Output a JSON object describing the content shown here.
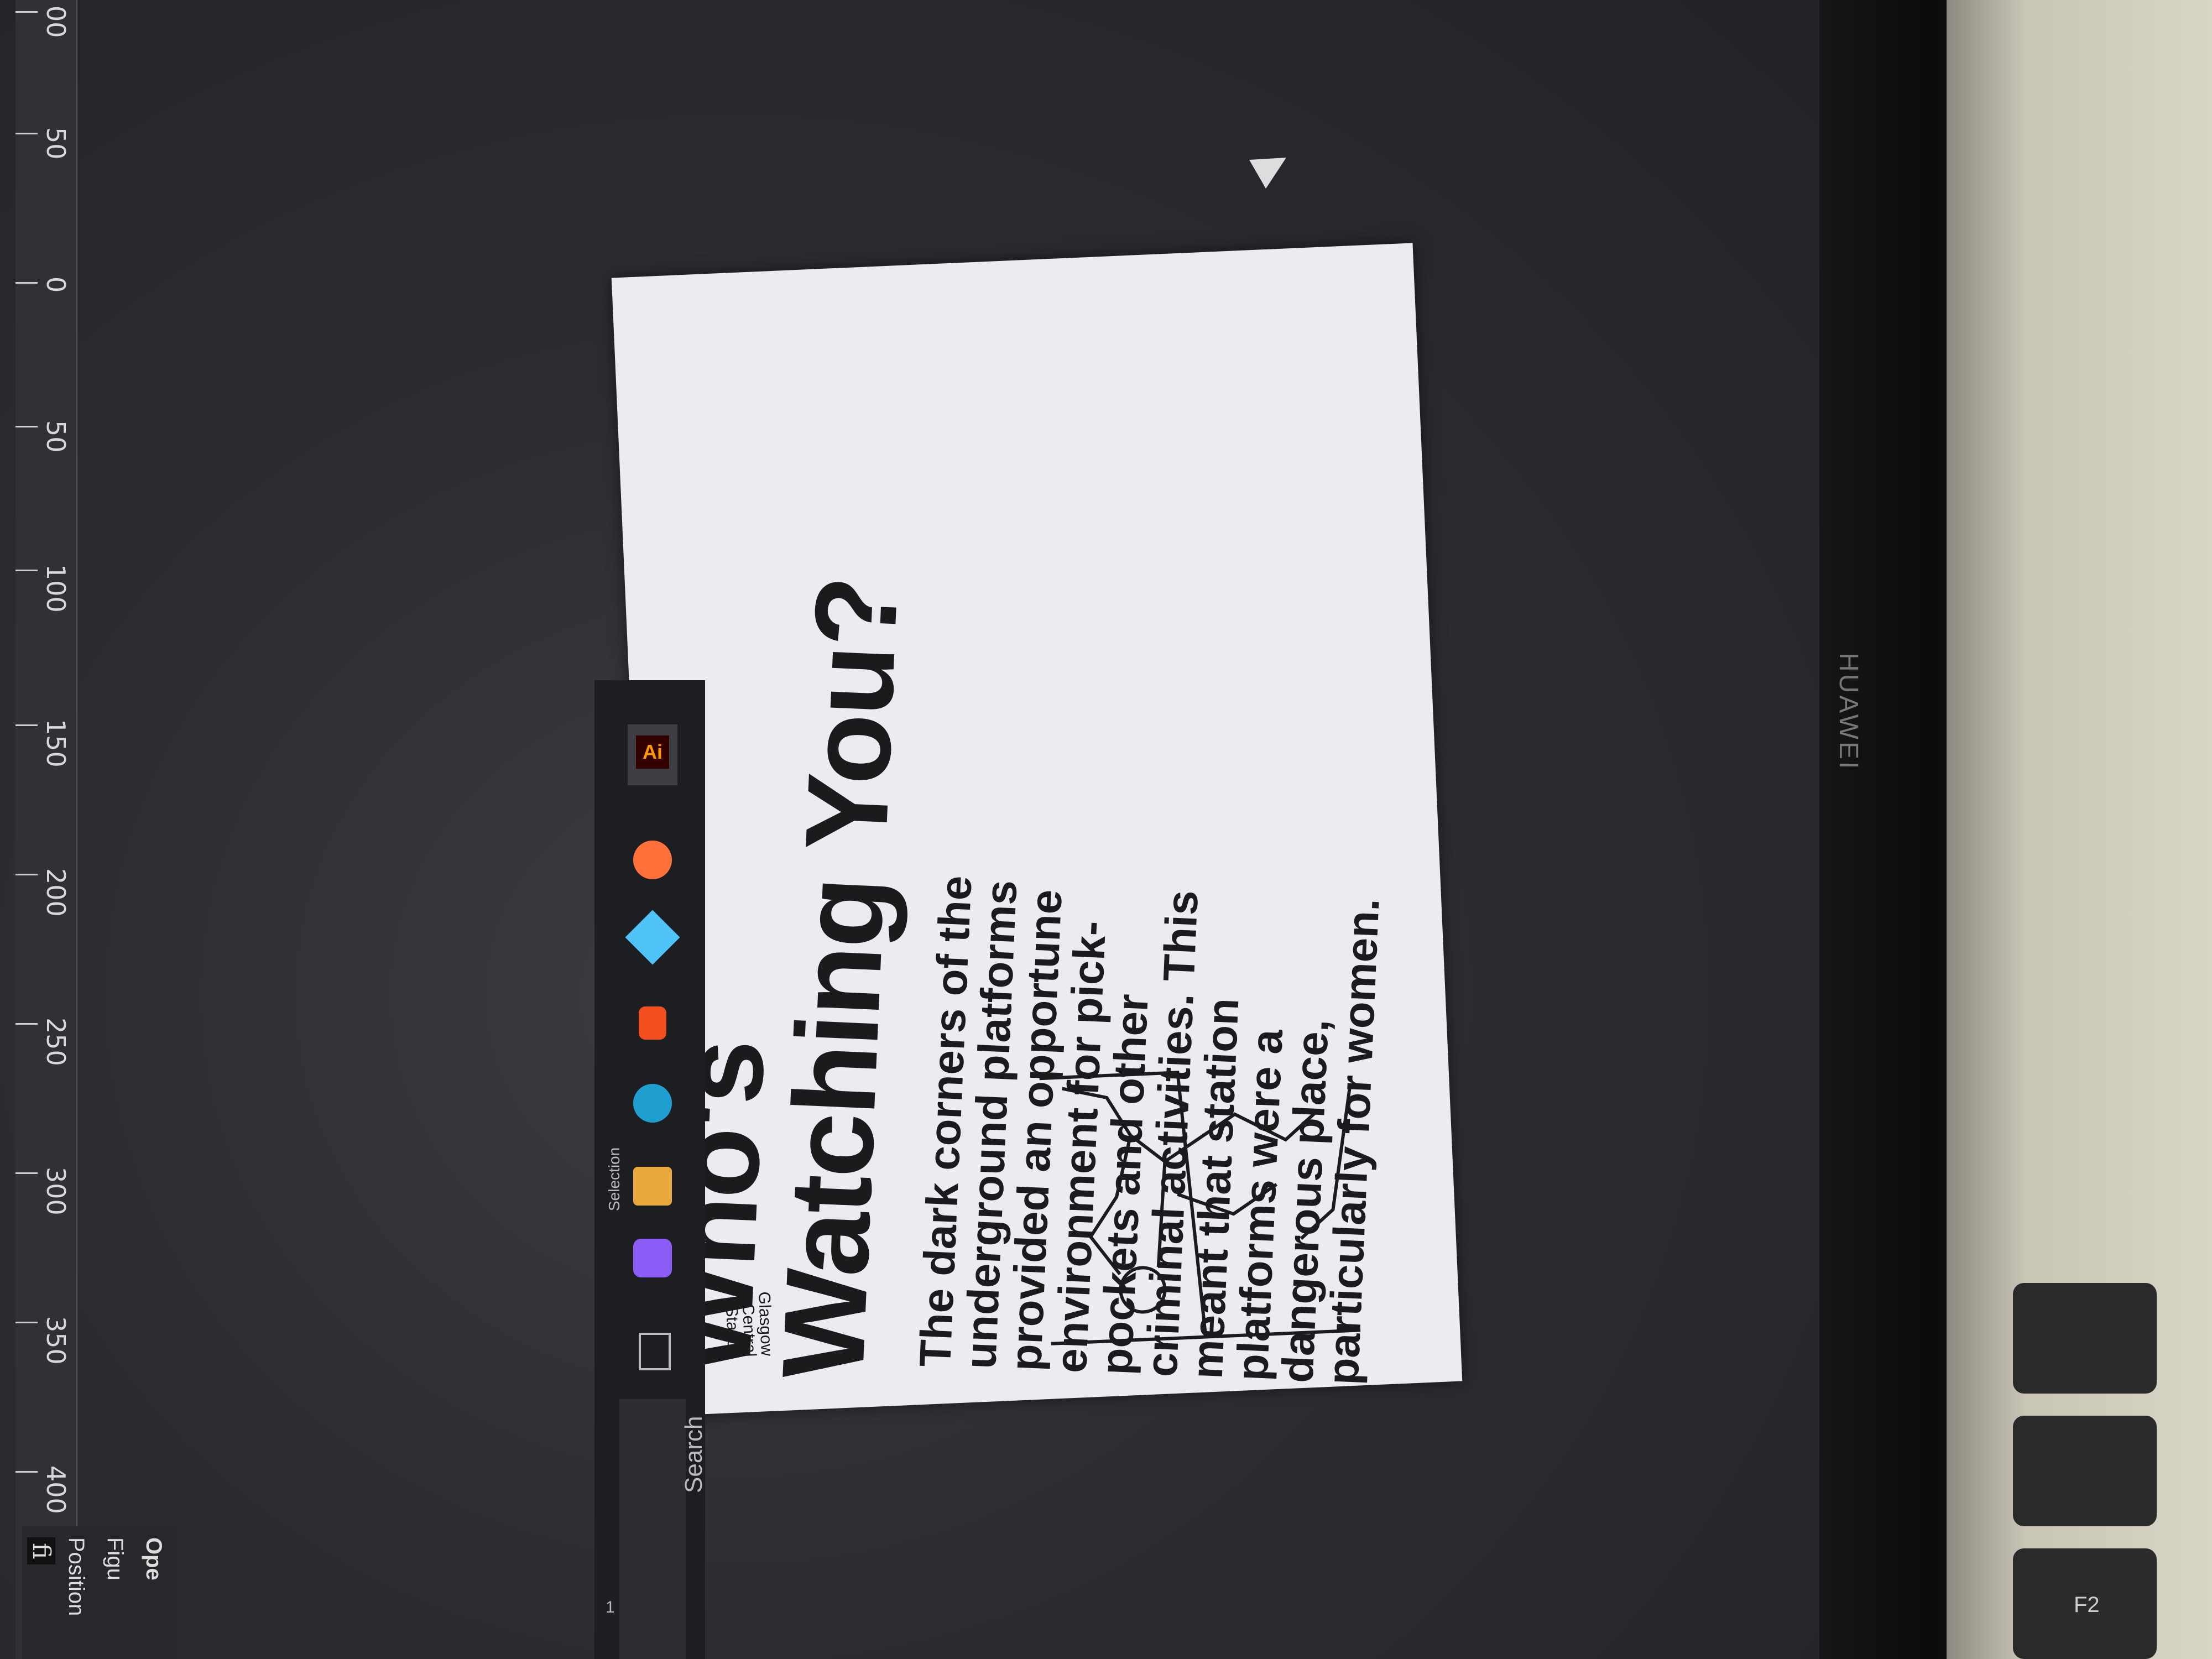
{
  "poster": {
    "title_line1": "Who's",
    "title_line2": "Watching You?",
    "body": "The dark corners of the underground platforms provided an opportune environment for pick-pockets and other criminal activities. This meant that station platforms were a dangerous place, particularly for women.",
    "logo_line1": "Glasgow",
    "logo_line2": "Central",
    "logo_line3": "Station"
  },
  "ruler": {
    "labels": [
      "00",
      "50",
      "0",
      "50",
      "100",
      "150",
      "200",
      "250",
      "300",
      "350",
      "400"
    ]
  },
  "taskbar": {
    "search_label": "Search",
    "page_number": "1",
    "selection_label": "Selection",
    "app_badge": "Ai"
  },
  "properties_panel": {
    "row1": "Ope",
    "row2": "Figu",
    "row3": "Position",
    "glyph": "fi"
  },
  "device": {
    "brand": "HUAWEI",
    "key_label": "F2"
  }
}
